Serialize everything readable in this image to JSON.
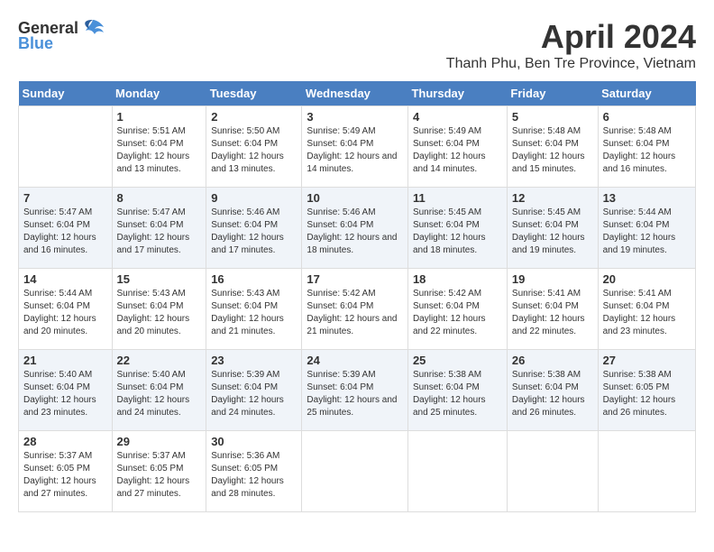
{
  "header": {
    "logo_general": "General",
    "logo_blue": "Blue",
    "month": "April 2024",
    "location": "Thanh Phu, Ben Tre Province, Vietnam"
  },
  "weekdays": [
    "Sunday",
    "Monday",
    "Tuesday",
    "Wednesday",
    "Thursday",
    "Friday",
    "Saturday"
  ],
  "rows": [
    [
      {
        "day": "",
        "sunrise": "",
        "sunset": "",
        "daylight": ""
      },
      {
        "day": "1",
        "sunrise": "5:51 AM",
        "sunset": "6:04 PM",
        "daylight": "12 hours and 13 minutes."
      },
      {
        "day": "2",
        "sunrise": "5:50 AM",
        "sunset": "6:04 PM",
        "daylight": "12 hours and 13 minutes."
      },
      {
        "day": "3",
        "sunrise": "5:49 AM",
        "sunset": "6:04 PM",
        "daylight": "12 hours and 14 minutes."
      },
      {
        "day": "4",
        "sunrise": "5:49 AM",
        "sunset": "6:04 PM",
        "daylight": "12 hours and 14 minutes."
      },
      {
        "day": "5",
        "sunrise": "5:48 AM",
        "sunset": "6:04 PM",
        "daylight": "12 hours and 15 minutes."
      },
      {
        "day": "6",
        "sunrise": "5:48 AM",
        "sunset": "6:04 PM",
        "daylight": "12 hours and 16 minutes."
      }
    ],
    [
      {
        "day": "7",
        "sunrise": "5:47 AM",
        "sunset": "6:04 PM",
        "daylight": "12 hours and 16 minutes."
      },
      {
        "day": "8",
        "sunrise": "5:47 AM",
        "sunset": "6:04 PM",
        "daylight": "12 hours and 17 minutes."
      },
      {
        "day": "9",
        "sunrise": "5:46 AM",
        "sunset": "6:04 PM",
        "daylight": "12 hours and 17 minutes."
      },
      {
        "day": "10",
        "sunrise": "5:46 AM",
        "sunset": "6:04 PM",
        "daylight": "12 hours and 18 minutes."
      },
      {
        "day": "11",
        "sunrise": "5:45 AM",
        "sunset": "6:04 PM",
        "daylight": "12 hours and 18 minutes."
      },
      {
        "day": "12",
        "sunrise": "5:45 AM",
        "sunset": "6:04 PM",
        "daylight": "12 hours and 19 minutes."
      },
      {
        "day": "13",
        "sunrise": "5:44 AM",
        "sunset": "6:04 PM",
        "daylight": "12 hours and 19 minutes."
      }
    ],
    [
      {
        "day": "14",
        "sunrise": "5:44 AM",
        "sunset": "6:04 PM",
        "daylight": "12 hours and 20 minutes."
      },
      {
        "day": "15",
        "sunrise": "5:43 AM",
        "sunset": "6:04 PM",
        "daylight": "12 hours and 20 minutes."
      },
      {
        "day": "16",
        "sunrise": "5:43 AM",
        "sunset": "6:04 PM",
        "daylight": "12 hours and 21 minutes."
      },
      {
        "day": "17",
        "sunrise": "5:42 AM",
        "sunset": "6:04 PM",
        "daylight": "12 hours and 21 minutes."
      },
      {
        "day": "18",
        "sunrise": "5:42 AM",
        "sunset": "6:04 PM",
        "daylight": "12 hours and 22 minutes."
      },
      {
        "day": "19",
        "sunrise": "5:41 AM",
        "sunset": "6:04 PM",
        "daylight": "12 hours and 22 minutes."
      },
      {
        "day": "20",
        "sunrise": "5:41 AM",
        "sunset": "6:04 PM",
        "daylight": "12 hours and 23 minutes."
      }
    ],
    [
      {
        "day": "21",
        "sunrise": "5:40 AM",
        "sunset": "6:04 PM",
        "daylight": "12 hours and 23 minutes."
      },
      {
        "day": "22",
        "sunrise": "5:40 AM",
        "sunset": "6:04 PM",
        "daylight": "12 hours and 24 minutes."
      },
      {
        "day": "23",
        "sunrise": "5:39 AM",
        "sunset": "6:04 PM",
        "daylight": "12 hours and 24 minutes."
      },
      {
        "day": "24",
        "sunrise": "5:39 AM",
        "sunset": "6:04 PM",
        "daylight": "12 hours and 25 minutes."
      },
      {
        "day": "25",
        "sunrise": "5:38 AM",
        "sunset": "6:04 PM",
        "daylight": "12 hours and 25 minutes."
      },
      {
        "day": "26",
        "sunrise": "5:38 AM",
        "sunset": "6:04 PM",
        "daylight": "12 hours and 26 minutes."
      },
      {
        "day": "27",
        "sunrise": "5:38 AM",
        "sunset": "6:05 PM",
        "daylight": "12 hours and 26 minutes."
      }
    ],
    [
      {
        "day": "28",
        "sunrise": "5:37 AM",
        "sunset": "6:05 PM",
        "daylight": "12 hours and 27 minutes."
      },
      {
        "day": "29",
        "sunrise": "5:37 AM",
        "sunset": "6:05 PM",
        "daylight": "12 hours and 27 minutes."
      },
      {
        "day": "30",
        "sunrise": "5:36 AM",
        "sunset": "6:05 PM",
        "daylight": "12 hours and 28 minutes."
      },
      {
        "day": "",
        "sunrise": "",
        "sunset": "",
        "daylight": ""
      },
      {
        "day": "",
        "sunrise": "",
        "sunset": "",
        "daylight": ""
      },
      {
        "day": "",
        "sunrise": "",
        "sunset": "",
        "daylight": ""
      },
      {
        "day": "",
        "sunrise": "",
        "sunset": "",
        "daylight": ""
      }
    ]
  ]
}
